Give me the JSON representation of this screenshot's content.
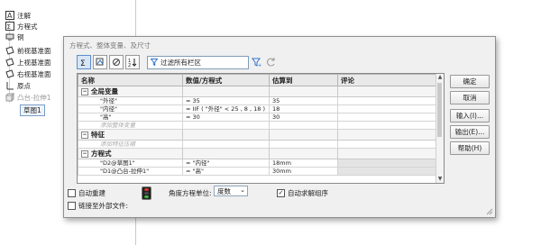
{
  "tree": {
    "items": [
      {
        "label": "注解",
        "icon": "annotations-icon"
      },
      {
        "label": "方程式",
        "icon": "equations-icon"
      },
      {
        "label": "铜",
        "icon": "material-icon"
      },
      {
        "label": "前视基准面",
        "icon": "plane-icon"
      },
      {
        "label": "上视基准面",
        "icon": "plane-icon"
      },
      {
        "label": "右视基准面",
        "icon": "plane-icon"
      },
      {
        "label": "原点",
        "icon": "origin-icon"
      },
      {
        "label": "凸台-拉伸1",
        "icon": "boss-extrude-icon"
      },
      {
        "label": "草图1",
        "icon": "sketch-icon"
      }
    ]
  },
  "dialog": {
    "title": "方程式、整体变量、及尺寸",
    "filter_placeholder": "过滤所有栏区",
    "columns": [
      "名称",
      "数值/方程式",
      "估算到",
      "评论"
    ],
    "sections": [
      {
        "label": "全局变量",
        "expander": "−",
        "rows": [
          {
            "name": "\"外径\"",
            "value": "= 35",
            "eval": "35",
            "comment": ""
          },
          {
            "name": "\"内径\"",
            "value": "= IIF ( \"外径\" < 25 , 8 , 18 )",
            "eval": "18",
            "comment": ""
          },
          {
            "name": "\"高\"",
            "value": "= 30",
            "eval": "30",
            "comment": ""
          }
        ],
        "add_label": "添加整体变量"
      },
      {
        "label": "特征",
        "expander": "−",
        "rows": [],
        "add_label": "添加特征压缩"
      },
      {
        "label": "方程式",
        "expander": "−",
        "rows": [
          {
            "name": "\"D2@草图1\"",
            "value": "= \"内径\"",
            "eval": "18mm",
            "comment": ""
          },
          {
            "name": "\"D1@凸台-拉伸1\"",
            "value": "= \"高\"",
            "eval": "30mm",
            "comment": ""
          }
        ]
      }
    ],
    "buttons": {
      "ok": "确定",
      "cancel": "取消",
      "import": "输入(I)...",
      "export": "输出(E)...",
      "help": "帮助(H)"
    },
    "auto_rebuild": {
      "label": "自动重建",
      "checked": false
    },
    "angle_unit": {
      "label": "角度方程单位:",
      "value": "度数"
    },
    "auto_solve": {
      "label": "自动求解组序",
      "checked": true
    },
    "link_external": {
      "label": "链接至外部文件:",
      "checked": false
    }
  }
}
